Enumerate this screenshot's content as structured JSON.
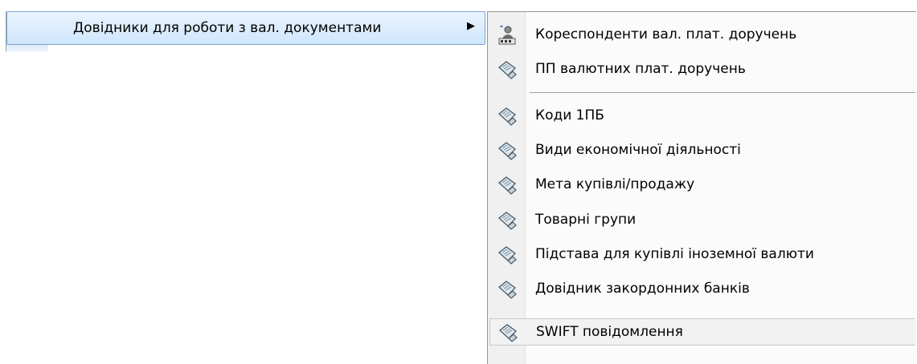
{
  "parent_menu": {
    "item_label": "Довідники для роботи з вал. документами",
    "arrow_glyph": "▶"
  },
  "submenu": {
    "items": [
      {
        "label": "Кореспонденти вал. плат. доручень",
        "icon": "correspondent-icon"
      },
      {
        "label": "ПП валютних плат. доручень",
        "icon": "document-hand-icon"
      },
      {
        "label": "Коди 1ПБ",
        "icon": "document-hand-icon"
      },
      {
        "label": "Види економічної діяльності",
        "icon": "document-hand-icon"
      },
      {
        "label": "Мета купівлі/продажу",
        "icon": "document-hand-icon"
      },
      {
        "label": "Товарні групи",
        "icon": "document-hand-icon"
      },
      {
        "label": "Підстава для купівлі іноземної валюти",
        "icon": "document-hand-icon"
      },
      {
        "label": "Довідник закордонних банків",
        "icon": "document-hand-icon"
      },
      {
        "label": "SWIFT повідомлення",
        "icon": "document-hand-icon"
      }
    ]
  },
  "colors": {
    "highlight_blue": "#cfe6fb",
    "highlight_border": "#7da2ce",
    "menu_background": "#fbfbfb"
  }
}
